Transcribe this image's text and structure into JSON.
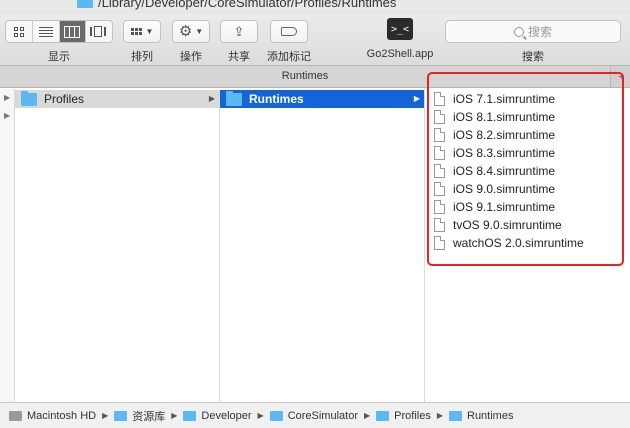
{
  "window": {
    "path_title": "/Library/Developer/CoreSimulator/Profiles/Runtimes"
  },
  "toolbar": {
    "view_label": "显示",
    "arrange_label": "排列",
    "action_label": "操作",
    "share_label": "共享",
    "tags_label": "添加标记",
    "go2shell_label": "Go2Shell.app",
    "search_label": "搜索",
    "search_placeholder": "搜索"
  },
  "tab": {
    "title": "Runtimes"
  },
  "columns": {
    "col1": {
      "items": [
        {
          "label": "Profiles",
          "state": "selected-inactive"
        }
      ]
    },
    "col2": {
      "items": [
        {
          "label": "Runtimes",
          "state": "selected-active"
        }
      ]
    },
    "col3": {
      "items": [
        {
          "label": "iOS 7.1.simruntime"
        },
        {
          "label": "iOS 8.1.simruntime"
        },
        {
          "label": "iOS 8.2.simruntime"
        },
        {
          "label": "iOS 8.3.simruntime"
        },
        {
          "label": "iOS 8.4.simruntime"
        },
        {
          "label": "iOS 9.0.simruntime"
        },
        {
          "label": "iOS 9.1.simruntime"
        },
        {
          "label": "tvOS 9.0.simruntime"
        },
        {
          "label": "watchOS 2.0.simruntime"
        }
      ]
    }
  },
  "pathbar": {
    "crumbs": [
      "Macintosh HD",
      "资源库",
      "Developer",
      "CoreSimulator",
      "Profiles",
      "Runtimes"
    ]
  },
  "colors": {
    "selection": "#1364d6",
    "folder": "#5cb8f0",
    "highlight_box": "#e8231f"
  }
}
